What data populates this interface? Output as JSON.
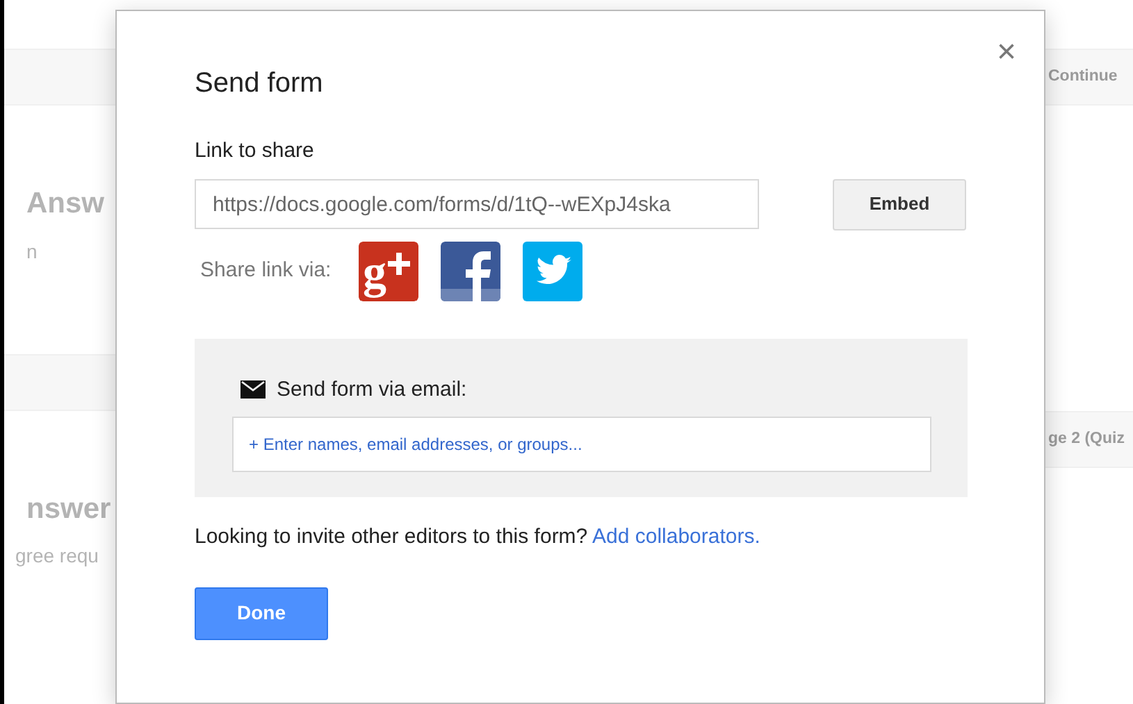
{
  "background": {
    "left_texts": [
      {
        "kind": "heading",
        "text": "Answ"
      },
      {
        "kind": "note",
        "text": "n"
      },
      {
        "kind": "bar"
      },
      {
        "kind": "heading",
        "text": "nswer"
      },
      {
        "kind": "note",
        "text": "gree requ"
      }
    ],
    "right_texts": [
      {
        "kind": "bar",
        "text": "Continue"
      },
      {
        "kind": "bar",
        "text": "ge 2 (Quiz"
      }
    ]
  },
  "dialog": {
    "title": "Send form",
    "close": "×",
    "link_label": "Link to share",
    "link_value": "https://docs.google.com/forms/d/1tQ--wEXpJ4ska",
    "embed_button": "Embed",
    "share_label": "Share link via:",
    "share_services": [
      {
        "kind": "googleplus",
        "glyph": "g"
      },
      {
        "kind": "facebook"
      },
      {
        "kind": "twitter"
      }
    ],
    "email_label": "Send form via email:",
    "email_placeholder": "+ Enter names, email addresses, or groups...",
    "invite_text": "Looking to invite other editors to this form?",
    "invite_link": "Add collaborators.",
    "done_button": "Done"
  }
}
